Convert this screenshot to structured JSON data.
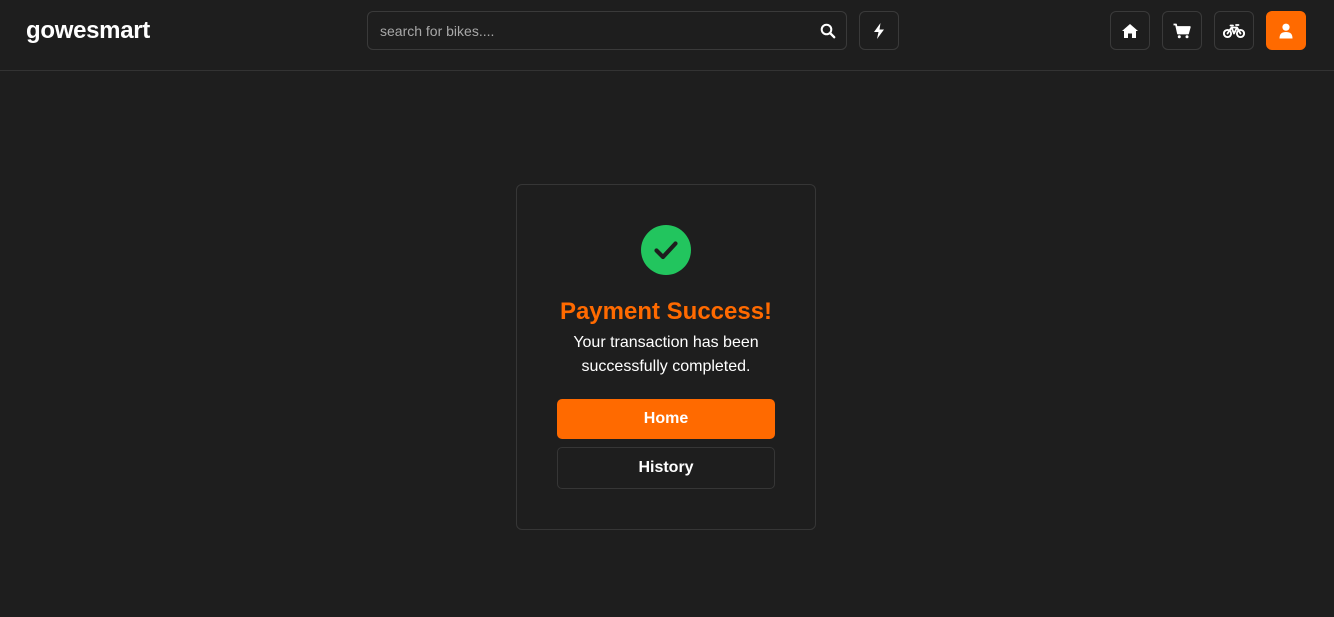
{
  "app": {
    "name": "gowesmart"
  },
  "colors": {
    "accent": "#ff6a00",
    "success": "#22c55e",
    "background": "#1e1e1e",
    "border": "#363636"
  },
  "search": {
    "placeholder": "search for bikes....",
    "value": "",
    "icon": "search-icon"
  },
  "nav": {
    "buttons": [
      {
        "icon": "lightning-icon"
      },
      {
        "icon": "home-icon"
      },
      {
        "icon": "cart-icon"
      },
      {
        "icon": "bicycle-icon"
      },
      {
        "icon": "user-icon",
        "active": true
      }
    ]
  },
  "result": {
    "icon": "check-circle-icon",
    "title": "Payment Success!",
    "message": "Your transaction has been successfully completed.",
    "primary_label": "Home",
    "secondary_label": "History"
  }
}
